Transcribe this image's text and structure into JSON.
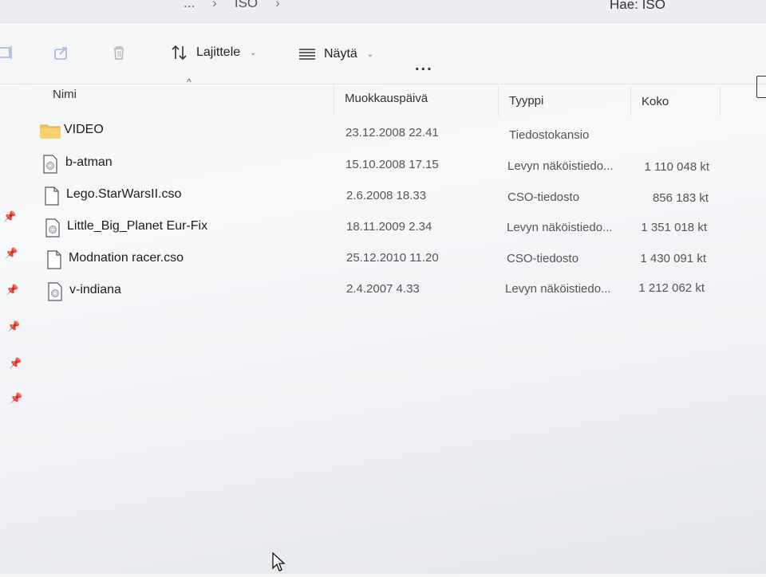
{
  "breadcrumb": {
    "prev": "...",
    "current": "ISO"
  },
  "search": {
    "placeholder": "Hae: ISO"
  },
  "toolbar": {
    "sort_label": "Lajittele",
    "view_label": "Näytä",
    "more_label": "..."
  },
  "columns": {
    "name": "Nimi",
    "modified": "Muokkauspäivä",
    "type": "Tyyppi",
    "size": "Koko"
  },
  "files": [
    {
      "name": "VIDEO",
      "modified": "23.12.2008 22.41",
      "type": "Tiedostokansio",
      "size": "",
      "icon": "folder-icon"
    },
    {
      "name": "b-atman",
      "modified": "15.10.2008 17.15",
      "type": "Levyn näköistiedo...",
      "size": "1 110 048 kt",
      "icon": "disc-image-file-icon"
    },
    {
      "name": "Lego.StarWarsII.cso",
      "modified": "2.6.2008 18.33",
      "type": "CSO-tiedosto",
      "size": "856 183 kt",
      "icon": "file-icon"
    },
    {
      "name": "Little_Big_Planet Eur-Fix",
      "modified": "18.11.2009 2.34",
      "type": "Levyn näköistiedo...",
      "size": "1 351 018 kt",
      "icon": "disc-image-file-icon"
    },
    {
      "name": "Modnation racer.cso",
      "modified": "25.12.2010 11.20",
      "type": "CSO-tiedosto",
      "size": "1 430 091 kt",
      "icon": "file-icon"
    },
    {
      "name": "v-indiana",
      "modified": "2.4.2007 4.33",
      "type": "Levyn näköistiedo...",
      "size": "1 212 062 kt",
      "icon": "disc-image-file-icon"
    }
  ],
  "colors": {
    "folder": "#f5c451",
    "accent": "#2e6fd0"
  }
}
